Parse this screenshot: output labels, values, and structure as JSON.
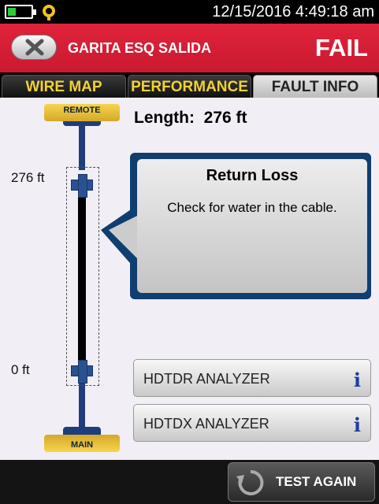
{
  "status_bar": {
    "datetime": "12/15/2016 4:49:18 am",
    "battery_icon": "battery-icon",
    "wifi_icon": "wifi-icon",
    "battery_color": "#2ecc3a"
  },
  "header": {
    "title": "GARITA ESQ SALIDA",
    "result": "FAIL",
    "back_icon": "close-icon",
    "background_color": "#d91f36"
  },
  "tabs": [
    {
      "label": "WIRE MAP",
      "active": false
    },
    {
      "label": "PERFORMANCE",
      "active": false
    },
    {
      "label": "FAULT INFO",
      "active": true
    }
  ],
  "cable_diagram": {
    "remote_label": "REMOTE",
    "main_label": "MAIN",
    "top_distance": "276 ft",
    "bottom_distance": "0 ft"
  },
  "length": {
    "label": "Length:",
    "value": "276 ft"
  },
  "fault": {
    "title": "Return Loss",
    "message": "Check for water in the cable."
  },
  "analyzers": [
    {
      "label": "HDTDR ANALYZER",
      "icon": "info-icon"
    },
    {
      "label": "HDTDX ANALYZER",
      "icon": "info-icon"
    }
  ],
  "footer": {
    "test_again_label": "TEST AGAIN",
    "test_again_icon": "refresh-icon"
  }
}
